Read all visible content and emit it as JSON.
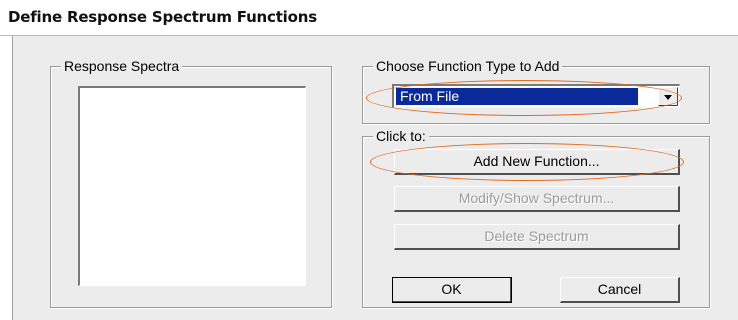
{
  "window": {
    "title": "Define Response Spectrum Functions"
  },
  "response_spectra": {
    "legend": "Response Spectra",
    "items": []
  },
  "function_type": {
    "legend": "Choose  Function Type to Add",
    "selected": "From File"
  },
  "click_to": {
    "legend": "Click to:",
    "add_label": "Add New Function...",
    "modify_label": "Modify/Show Spectrum...",
    "delete_label": "Delete Spectrum"
  },
  "buttons": {
    "ok_label": "OK",
    "cancel_label": "Cancel"
  },
  "colors": {
    "highlight_annotation": "#e06a1e",
    "selection": "#0a2a9a",
    "dialog_bg": "#ececec"
  }
}
